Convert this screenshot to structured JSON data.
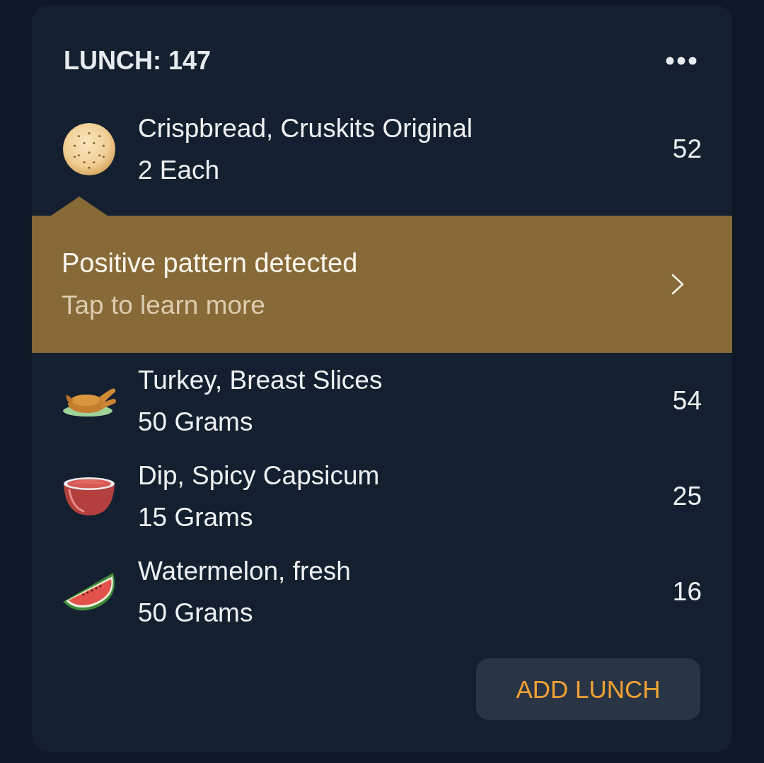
{
  "meal": {
    "title": "LUNCH: 147"
  },
  "entries": [
    {
      "kind": "cracker",
      "name": "Crispbread, Cruskits Original",
      "amount": "2 Each",
      "calories": "52"
    },
    {
      "kind": "insight",
      "title": "Positive pattern detected",
      "subtitle": "Tap to learn more"
    },
    {
      "kind": "chicken",
      "name": "Turkey, Breast Slices",
      "amount": "50 Grams",
      "calories": "54"
    },
    {
      "kind": "bowl",
      "name": "Dip, Spicy Capsicum",
      "amount": "15 Grams",
      "calories": "25"
    },
    {
      "kind": "watermelon",
      "name": "Watermelon, fresh",
      "amount": "50 Grams",
      "calories": "16"
    }
  ],
  "add_button": {
    "label": "ADD LUNCH"
  }
}
